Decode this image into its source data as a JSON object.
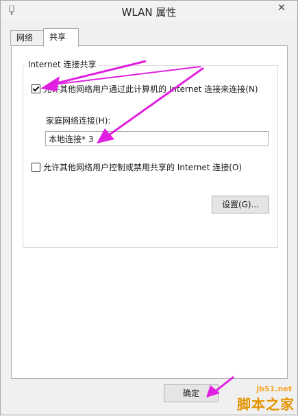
{
  "window": {
    "title": "WLAN 属性",
    "close_glyph": "✕"
  },
  "tabs": [
    {
      "label": "网络",
      "active": false
    },
    {
      "label": "共享",
      "active": true
    }
  ],
  "sharing": {
    "group_title": "Internet 连接共享",
    "allow_connect": {
      "checked": true,
      "label": "允许其他网络用户通过此计算机的 Internet 连接来连接(N)"
    },
    "home_network_label": "家庭网络连接(H):",
    "home_network_value": "本地连接* 3",
    "allow_control": {
      "checked": false,
      "label": "允许其他网络用户控制或禁用共享的 Internet 连接(O)"
    },
    "settings_button": "设置(G)..."
  },
  "footer": {
    "ok_button": "确定"
  },
  "annotations": {
    "arrow_color": "#e020e0"
  },
  "watermark": {
    "site": "jb51.net",
    "brand": "脚本之家"
  }
}
